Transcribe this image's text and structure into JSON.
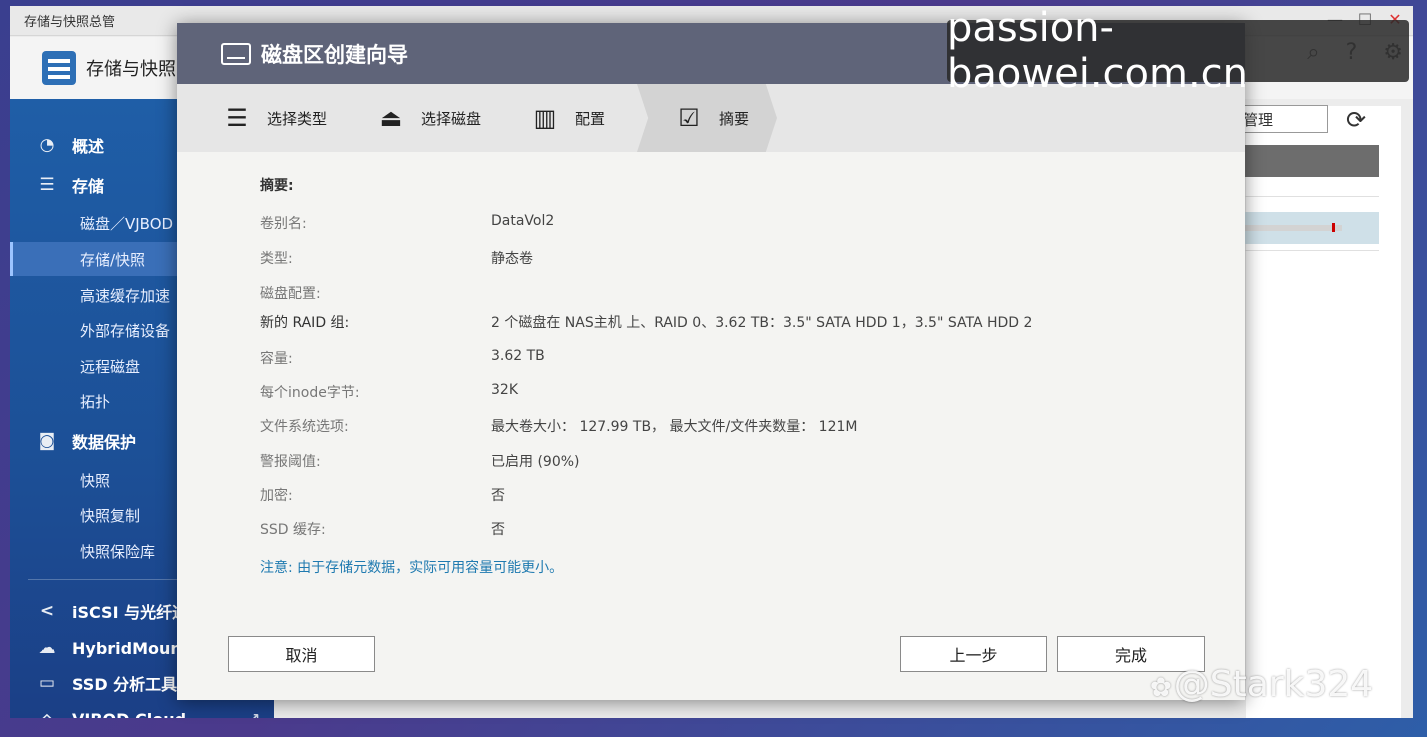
{
  "app": {
    "window_title": "存储与快照总管",
    "header_title": "存储与快照",
    "win_controls": [
      "—",
      "☐",
      "✕"
    ]
  },
  "sidebar": {
    "sections": [
      {
        "label": "概述",
        "icon": "gauge-icon"
      },
      {
        "label": "存储",
        "icon": "database-icon"
      },
      {
        "label": "数据保护",
        "icon": "camera-icon"
      },
      {
        "label": "iSCSI 与光纤通",
        "icon": "share-icon"
      },
      {
        "label": "HybridMount",
        "icon": "cloud-mount-icon"
      },
      {
        "label": "SSD 分析工具",
        "icon": "ssd-icon"
      },
      {
        "label": "VJBOD Cloud",
        "icon": "vjbod-cloud-icon"
      }
    ],
    "storage_items": [
      "磁盘／VJBOD",
      "存储/快照",
      "高速缓存加速",
      "外部存储设备",
      "远程磁盘",
      "拓扑"
    ],
    "protection_items": [
      "快照",
      "快照复制",
      "快照保险库"
    ]
  },
  "background": {
    "manage_label": "管理"
  },
  "wizard": {
    "title": "磁盘区创建向导",
    "steps": [
      {
        "label": "选择类型",
        "icon": "list-icon"
      },
      {
        "label": "选择磁盘",
        "icon": "disk-icon"
      },
      {
        "label": "配置",
        "icon": "config-icon"
      },
      {
        "label": "摘要",
        "icon": "clipboard-check-icon"
      }
    ],
    "summary": {
      "heading": "摘要:",
      "rows": [
        {
          "label": "卷别名:",
          "value": "DataVol2"
        },
        {
          "label": "类型:",
          "value": "静态卷"
        },
        {
          "label": "磁盘配置:",
          "value": ""
        },
        {
          "label": "新的 RAID 组:",
          "value": "2 个磁盘在 NAS主机 上、RAID 0、3.62 TB：3.5\" SATA HDD 1，3.5\" SATA HDD 2"
        },
        {
          "label": "容量:",
          "value": "3.62 TB"
        },
        {
          "label": "每个inode字节:",
          "value": "32K"
        },
        {
          "label": "文件系统选项:",
          "value": "最大卷大小： 127.99 TB， 最大文件/文件夹数量： 121M"
        },
        {
          "label": "警报阈值:",
          "value": "已启用 (90%)"
        },
        {
          "label": "加密:",
          "value": "否"
        },
        {
          "label": "SSD 缓存:",
          "value": "否"
        }
      ],
      "note": "注意: 由于存储元数据，实际可用容量可能更小。"
    },
    "buttons": {
      "cancel": "取消",
      "back": "上一步",
      "finish": "完成"
    }
  },
  "watermarks": {
    "top": "passion-baowei.com.cn",
    "bottom": "@Stark324"
  }
}
